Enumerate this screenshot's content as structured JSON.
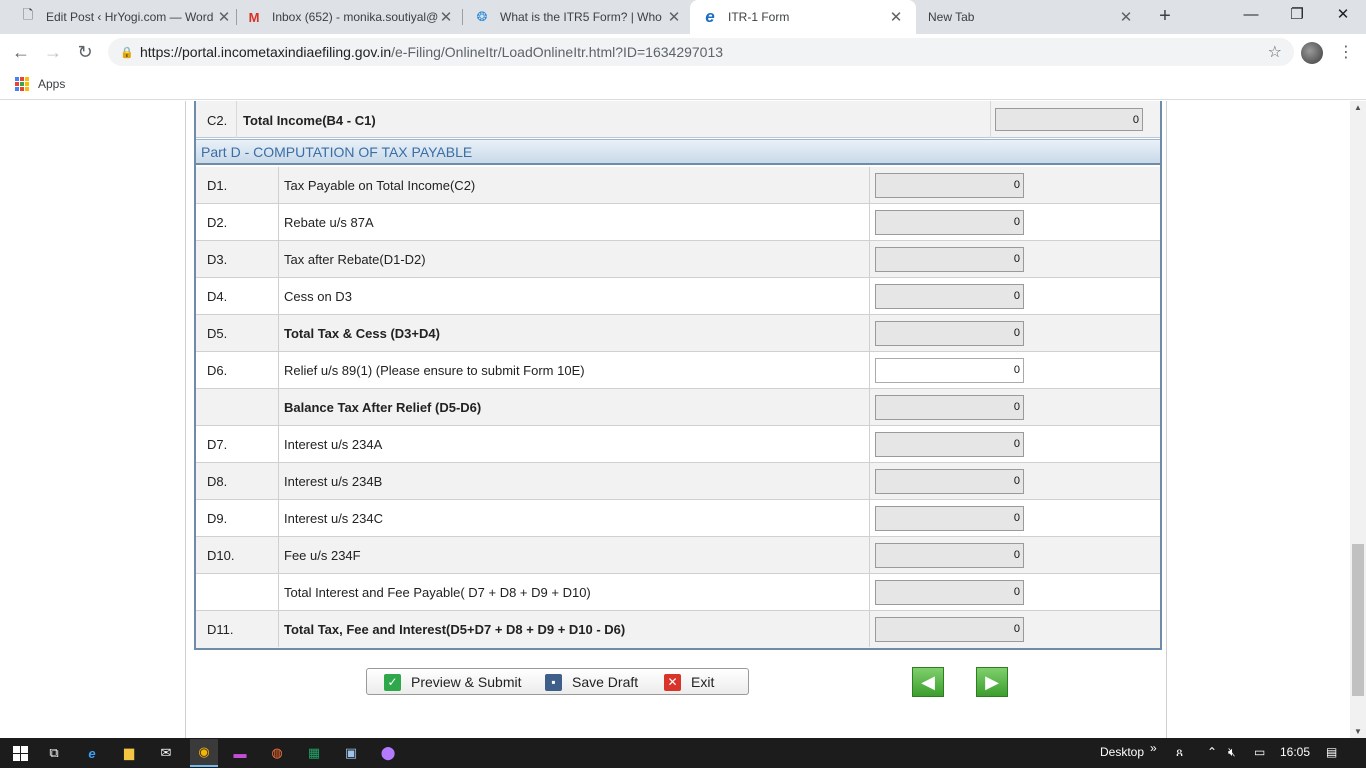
{
  "browser": {
    "tabs": [
      {
        "title": "Edit Post ‹ HrYogi.com — Word",
        "icon": "document-icon"
      },
      {
        "title": "Inbox (652) - monika.soutiyal@",
        "icon": "gmail-icon"
      },
      {
        "title": "What is the ITR5 Form? | Who",
        "icon": "site-icon"
      },
      {
        "title": "ITR-1 Form",
        "icon": "ie-icon"
      },
      {
        "title": "New Tab",
        "icon": ""
      }
    ],
    "url_host": "https://portal.incometaxindiaefiling.gov.in",
    "url_path": "/e-Filing/OnlineItr/LoadOnlineItr.html?ID=1634297013",
    "bookmarks_apps": "Apps"
  },
  "form": {
    "c2": {
      "code": "C2.",
      "label": "Total Income(B4 - C1)",
      "value": "0"
    },
    "part_header": "Part D - COMPUTATION OF TAX PAYABLE",
    "rows": [
      {
        "code": "D1.",
        "label": "Tax Payable on Total Income(C2)",
        "value": "0"
      },
      {
        "code": "D2.",
        "label": "Rebate u/s 87A",
        "value": "0"
      },
      {
        "code": "D3.",
        "label": "Tax after Rebate(D1-D2)",
        "value": "0"
      },
      {
        "code": "D4.",
        "label": "Cess on D3",
        "value": "0"
      },
      {
        "code": "D5.",
        "label": "Total Tax & Cess (D3+D4)",
        "value": "0"
      },
      {
        "code": "D6.",
        "label": "Relief u/s 89(1) (Please ensure to submit Form 10E)",
        "value": "0"
      },
      {
        "code": "",
        "label": "Balance Tax After Relief (D5-D6)",
        "value": "0"
      },
      {
        "code": "D7.",
        "label": "Interest u/s 234A",
        "value": "0"
      },
      {
        "code": "D8.",
        "label": "Interest u/s 234B",
        "value": "0"
      },
      {
        "code": "D9.",
        "label": "Interest u/s 234C",
        "value": "0"
      },
      {
        "code": "D10.",
        "label": "Fee u/s 234F",
        "value": "0"
      },
      {
        "code": "",
        "label": "Total Interest and Fee Payable( D7 + D8 + D9 + D10)",
        "value": "0"
      },
      {
        "code": "D11.",
        "label": "Total Tax, Fee and Interest(D5+D7 + D8 + D9 + D10 - D6)",
        "value": "0"
      }
    ]
  },
  "actions": {
    "preview_submit": "Preview & Submit",
    "save_draft": "Save Draft",
    "exit": "Exit"
  },
  "taskbar": {
    "desktop_label": "Desktop",
    "time": "16:05"
  }
}
